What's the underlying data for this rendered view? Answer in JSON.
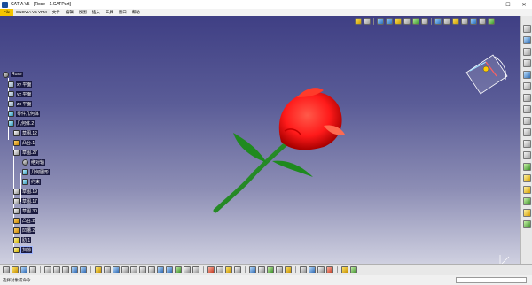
{
  "window": {
    "title": "CATIA V5 - [Rose - 1.CATPart]",
    "min_glyph": "—",
    "max_glyph": "☐",
    "close_glyph": "✕"
  },
  "menu": [
    "File",
    "ENOVIA V5 VPM",
    "文件",
    "编辑",
    "视图",
    "插入",
    "工具",
    "窗口",
    "帮助"
  ],
  "tree": {
    "root": "Rose",
    "nodes": [
      {
        "label": "xy 平面",
        "icon": "plane-icon"
      },
      {
        "label": "yz 平面",
        "icon": "plane-icon"
      },
      {
        "label": "zx 平面",
        "icon": "plane-icon"
      },
      {
        "label": "零件几何体",
        "icon": "body-icon"
      },
      {
        "label": "几何体.2",
        "icon": "body-icon"
      },
      {
        "label": "草图.12",
        "icon": "sketch-icon"
      },
      {
        "label": "凸台.1",
        "icon": "pad-icon"
      },
      {
        "label": "草图.27",
        "icon": "sketch-icon"
      },
      {
        "label": "绝对轴",
        "icon": "axis-system-icon"
      },
      {
        "label": "几何图形",
        "icon": "geometry-icon"
      },
      {
        "label": "约束",
        "icon": "constraint-icon"
      },
      {
        "label": "草图.19",
        "icon": "sketch-icon"
      },
      {
        "label": "草图.17",
        "icon": "sketch-icon"
      },
      {
        "label": "草图.30",
        "icon": "sketch-icon"
      },
      {
        "label": "凸台.2",
        "icon": "pad-icon"
      },
      {
        "label": "凹槽.2",
        "icon": "pocket-icon"
      },
      {
        "label": "肋.1",
        "icon": "rib-icon"
      },
      {
        "label": "扫掠",
        "icon": "sweep-icon"
      }
    ]
  },
  "status": {
    "text": "选择对象或命令"
  },
  "colors": {
    "viewport_top": "#3f3f84",
    "viewport_bottom": "#cfd0e0",
    "rose_petal": "#ff1a1a",
    "stem": "#1f8a1f",
    "file_menu_bg": "#f5c400"
  }
}
